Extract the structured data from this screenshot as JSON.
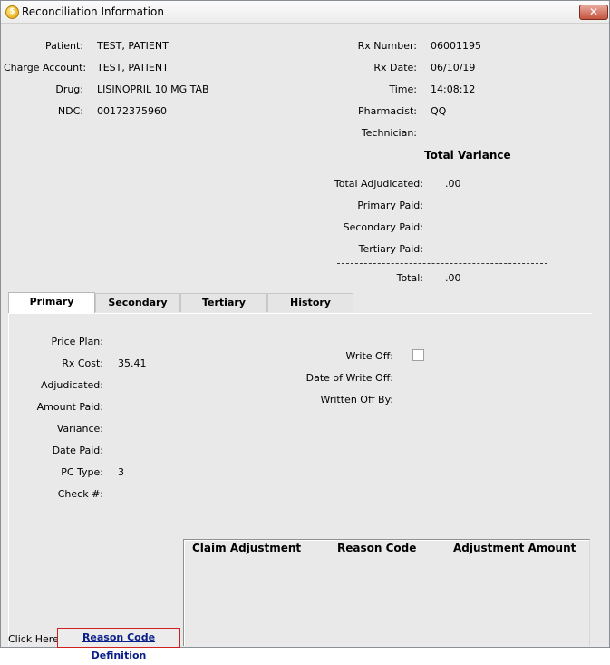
{
  "window": {
    "title": "Reconciliation Information",
    "close_glyph": "✕",
    "app_icon_glyph": "$"
  },
  "patient_info": {
    "patient_label": "Patient:",
    "patient_value": "TEST, PATIENT",
    "charge_account_label": "Charge Account:",
    "charge_account_value": "TEST, PATIENT",
    "drug_label": "Drug:",
    "drug_value": "LISINOPRIL 10 MG TAB",
    "ndc_label": "NDC:",
    "ndc_value": "00172375960"
  },
  "rx_info": {
    "rx_number_label": "Rx Number:",
    "rx_number_value": "06001195",
    "rx_date_label": "Rx Date:",
    "rx_date_value": "06/10/19",
    "time_label": "Time:",
    "time_value": "14:08:12",
    "pharmacist_label": "Pharmacist:",
    "pharmacist_value": "QQ",
    "technician_label": "Technician:",
    "technician_value": ""
  },
  "total_variance": {
    "heading": "Total Variance",
    "total_adjudicated_label": "Total Adjudicated:",
    "total_adjudicated_value": ".00",
    "primary_paid_label": "Primary Paid:",
    "primary_paid_value": "",
    "secondary_paid_label": "Secondary Paid:",
    "secondary_paid_value": "",
    "tertiary_paid_label": "Tertiary Paid:",
    "tertiary_paid_value": "",
    "total_label": "Total:",
    "total_value": ".00"
  },
  "tabs": [
    {
      "label": "Primary",
      "active": true
    },
    {
      "label": "Secondary",
      "active": false
    },
    {
      "label": "Tertiary",
      "active": false
    },
    {
      "label": "History",
      "active": false
    }
  ],
  "primary_tab": {
    "price_plan_label": "Price Plan:",
    "price_plan_value": "",
    "rx_cost_label": "Rx Cost:",
    "rx_cost_value": "35.41",
    "adjudicated_label": "Adjudicated:",
    "adjudicated_value": "",
    "amount_paid_label": "Amount Paid:",
    "amount_paid_value": "",
    "variance_label": "Variance:",
    "variance_value": "",
    "date_paid_label": "Date Paid:",
    "date_paid_value": "",
    "pc_type_label": "PC Type:",
    "pc_type_value": "3",
    "check_label": "Check #:",
    "check_value": "",
    "write_off_label": "Write Off:",
    "write_off_checked": false,
    "date_of_write_off_label": "Date of Write Off:",
    "date_of_write_off_value": "",
    "written_off_by_label": "Written Off By:",
    "written_off_by_value": ""
  },
  "adjustment_table": {
    "columns": [
      "Claim Adjustment",
      "Reason Code",
      "Adjustment Amount"
    ],
    "rows": []
  },
  "footer": {
    "click_here_label": "Click Here:",
    "reason_link_label": "Reason Code Definition"
  },
  "colors": {
    "link": "#0a1f8a",
    "link_border": "#d02020",
    "panel_bg": "#e9e9e9"
  }
}
